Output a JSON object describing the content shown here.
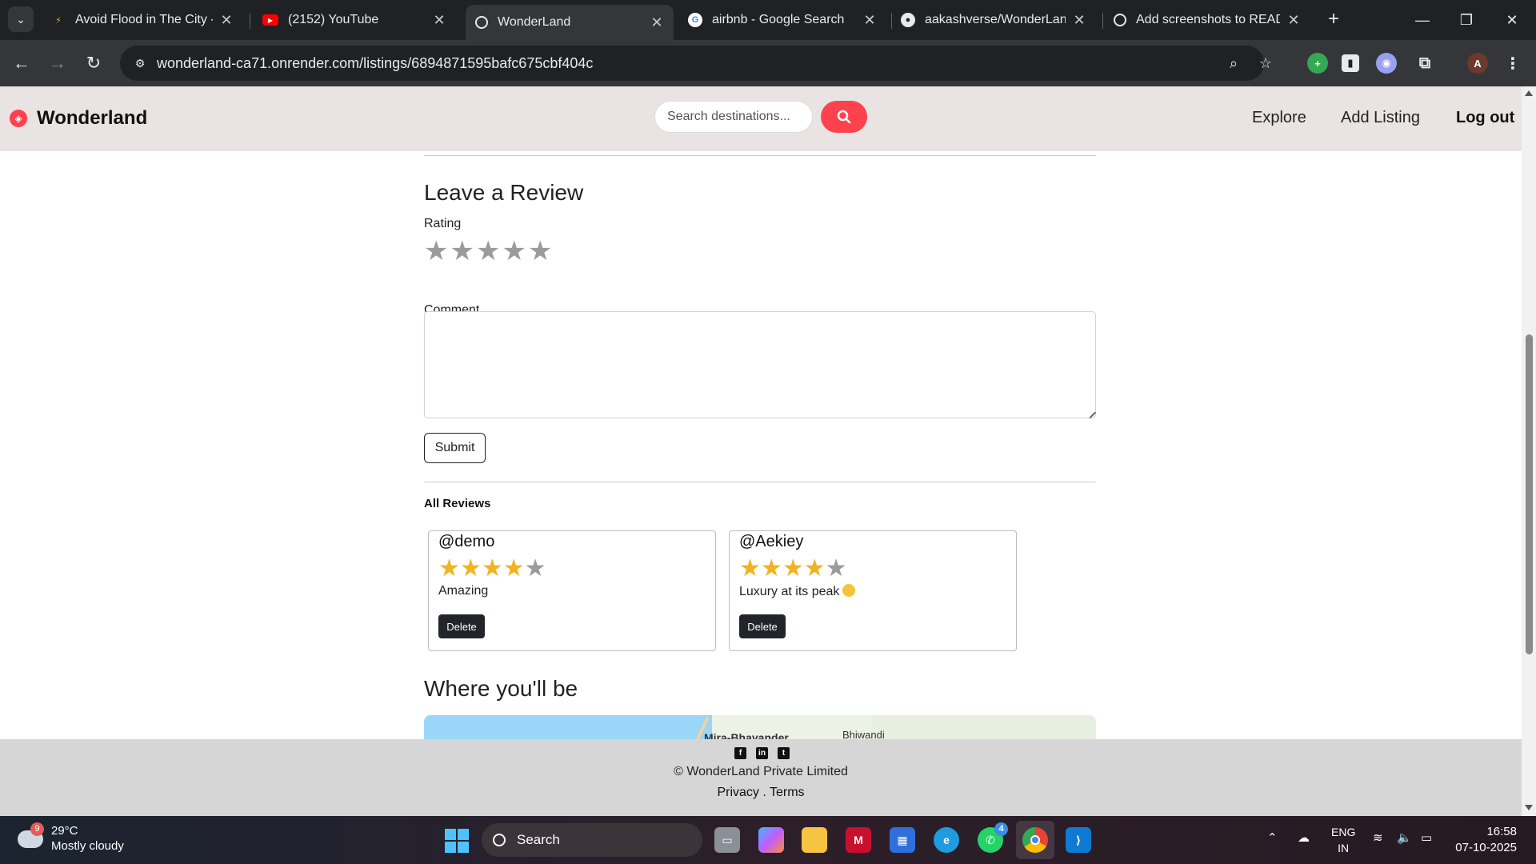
{
  "browser": {
    "tabs": [
      {
        "title": "Avoid Flood in The City - L",
        "icon": "lightning-favicon-icon"
      },
      {
        "title": "(2152) YouTube",
        "icon": "youtube-icon"
      },
      {
        "title": "WonderLand",
        "icon": "globe-icon"
      },
      {
        "title": "airbnb - Google Search",
        "icon": "google-icon"
      },
      {
        "title": "aakashverse/WonderLand:",
        "icon": "github-icon"
      },
      {
        "title": "Add screenshots to READM",
        "icon": "openai-icon"
      }
    ],
    "active_tab_index": 2,
    "url": "wonderland-ca71.onrender.com/listings/6894871595bafc675cbf404c"
  },
  "site": {
    "brand": "Wonderland",
    "search_placeholder": "Search destinations...",
    "nav": {
      "explore": "Explore",
      "add_listing": "Add Listing",
      "logout": "Log out"
    }
  },
  "review_form": {
    "heading": "Leave a Review",
    "rating_label": "Rating",
    "rating_value": 0,
    "rating_max": 5,
    "comment_label": "Comment",
    "comment_value": "",
    "submit_label": "Submit"
  },
  "reviews": {
    "heading": "All Reviews",
    "items": [
      {
        "user": "@demo",
        "rating": 4,
        "max": 5,
        "comment": "Amazing",
        "delete_label": "Delete"
      },
      {
        "user": "@Aekiey",
        "rating": 4,
        "max": 5,
        "comment": "Luxury at its peak",
        "delete_label": "Delete"
      }
    ]
  },
  "location": {
    "heading": "Where you'll be",
    "map_labels": [
      "Mira-Bhayander",
      "Bhiwandi"
    ]
  },
  "footer": {
    "copyright": "© WonderLand Private Limited",
    "privacy": "Privacy",
    "separator": " . ",
    "terms": "Terms",
    "social": [
      "facebook-icon",
      "linkedin-icon",
      "twitter-icon"
    ]
  },
  "taskbar": {
    "weather_badge": "9",
    "temperature": "29°C",
    "weather_desc": "Mostly cloudy",
    "search_label": "Search",
    "whatsapp_badge": "4",
    "lang_top": "ENG",
    "lang_bottom": "IN",
    "time": "16:58",
    "date": "07-10-2025"
  },
  "colors": {
    "brand_red": "#fe424d",
    "star_on": "#f0b323",
    "star_off": "#9b9b9b",
    "nav_bg": "#e9e3e4"
  }
}
